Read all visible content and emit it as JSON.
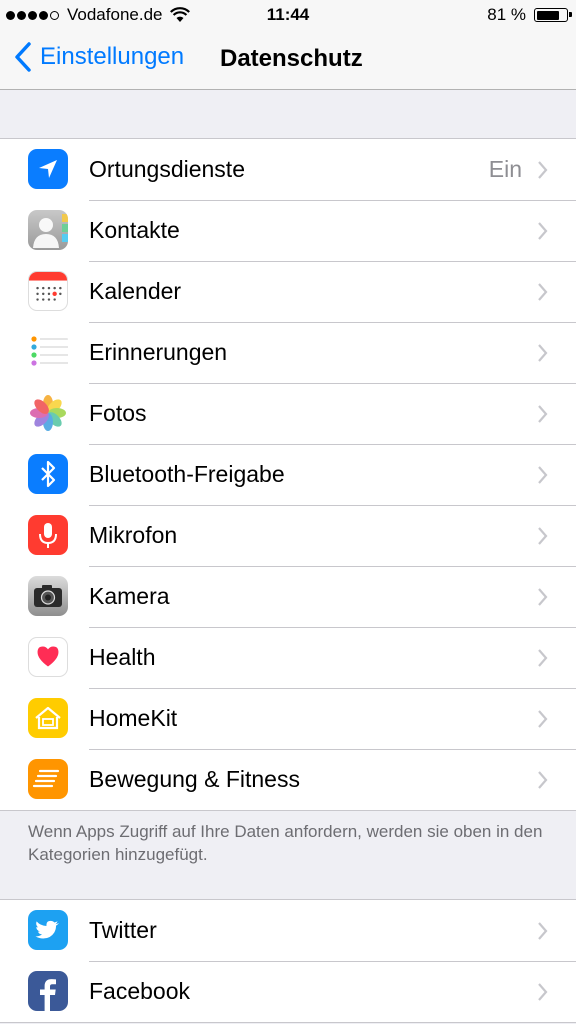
{
  "status_bar": {
    "carrier": "Vodafone.de",
    "time": "11:44",
    "battery_percent_label": "81 %",
    "battery_level": 0.81,
    "signal_bars_filled": 4,
    "signal_bars_total": 5
  },
  "nav": {
    "back_label": "Einstellungen",
    "title": "Datenschutz"
  },
  "privacy_items": [
    {
      "label": "Ortungsdienste",
      "value": "Ein",
      "icon": "location-arrow-icon"
    },
    {
      "label": "Kontakte",
      "value": "",
      "icon": "contacts-icon"
    },
    {
      "label": "Kalender",
      "value": "",
      "icon": "calendar-icon"
    },
    {
      "label": "Erinnerungen",
      "value": "",
      "icon": "reminders-icon"
    },
    {
      "label": "Fotos",
      "value": "",
      "icon": "photos-icon"
    },
    {
      "label": "Bluetooth-Freigabe",
      "value": "",
      "icon": "bluetooth-icon"
    },
    {
      "label": "Mikrofon",
      "value": "",
      "icon": "microphone-icon"
    },
    {
      "label": "Kamera",
      "value": "",
      "icon": "camera-icon"
    },
    {
      "label": "Health",
      "value": "",
      "icon": "health-heart-icon"
    },
    {
      "label": "HomeKit",
      "value": "",
      "icon": "homekit-icon"
    },
    {
      "label": "Bewegung & Fitness",
      "value": "",
      "icon": "motion-fitness-icon"
    }
  ],
  "footer_note": "Wenn Apps Zugriff auf Ihre Daten anfordern, werden sie oben in den Kategorien hinzugefügt.",
  "social_items": [
    {
      "label": "Twitter",
      "icon": "twitter-icon"
    },
    {
      "label": "Facebook",
      "icon": "facebook-icon"
    }
  ],
  "colors": {
    "accent": "#007aff",
    "background": "#efeff4",
    "separator": "#c8c7cc",
    "secondary_text": "#8e8e93"
  }
}
